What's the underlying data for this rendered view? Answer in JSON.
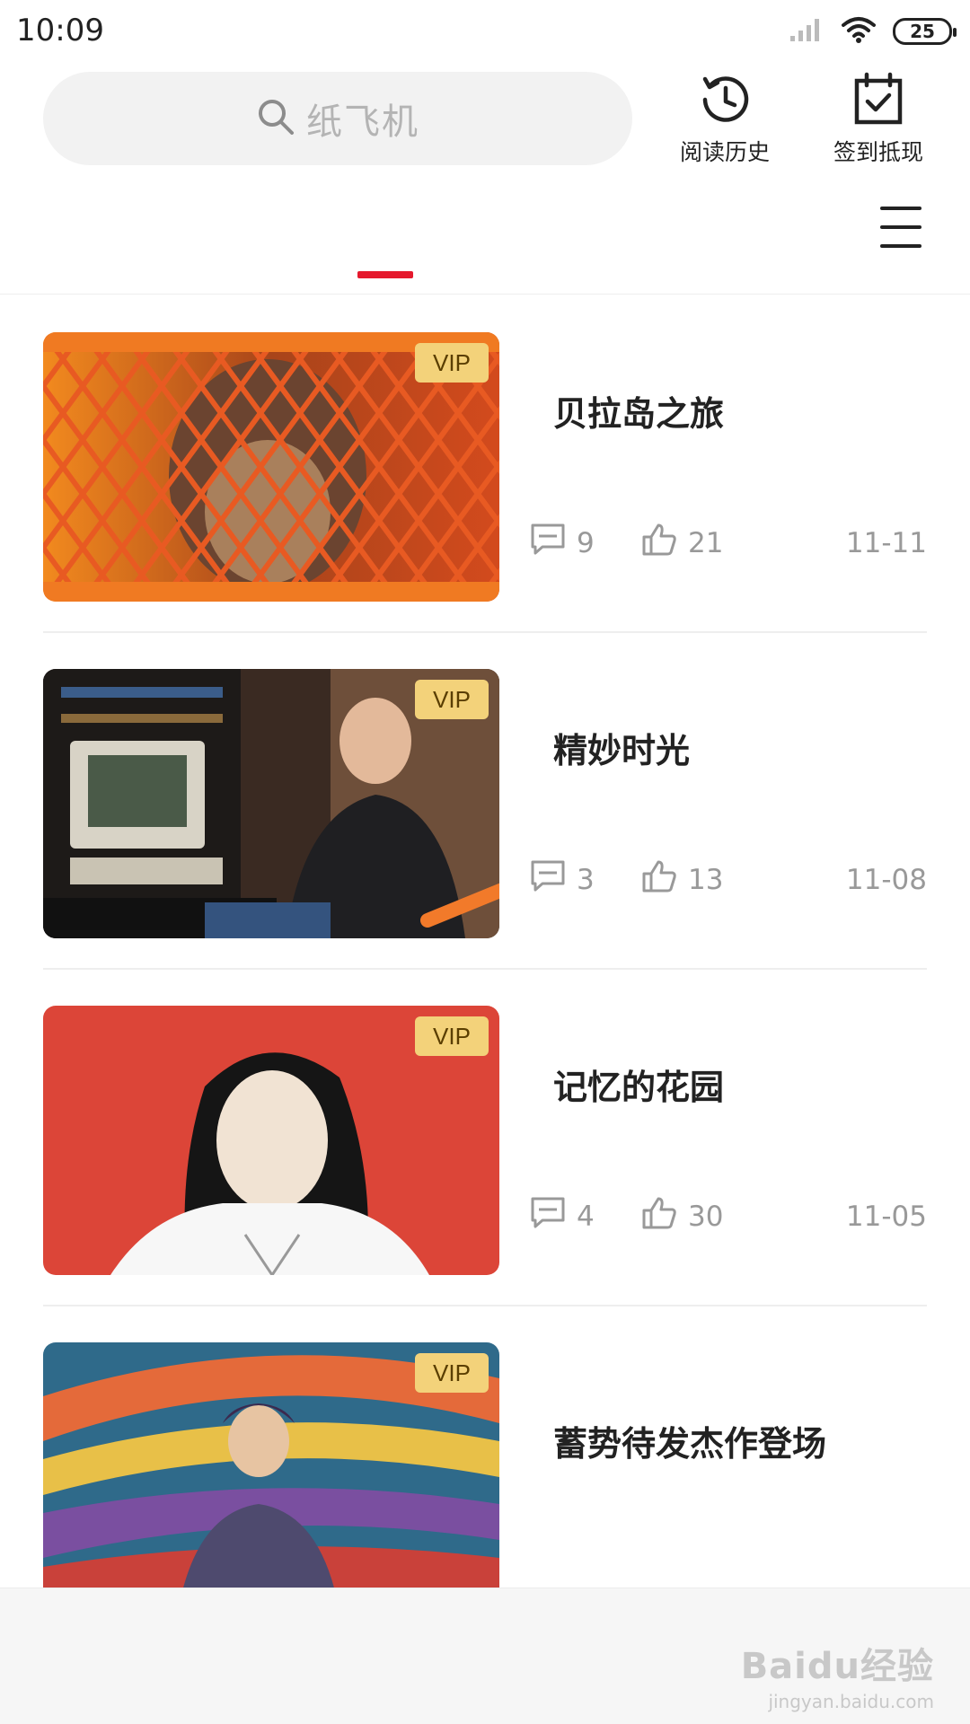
{
  "status_bar": {
    "time": "10:09",
    "battery": "25",
    "icons": [
      "signal-icon",
      "wifi-icon",
      "battery-icon"
    ]
  },
  "header": {
    "search_placeholder": "纸飞机",
    "history_label": "阅读历史",
    "checkin_label": "签到抵现"
  },
  "colors": {
    "accent": "#e5192d",
    "vip_badge": "#f3d27a",
    "meta_text": "#999999"
  },
  "feed": {
    "items": [
      {
        "title": "贝拉岛之旅",
        "comments": "9",
        "likes": "21",
        "date": "11-11",
        "badge": "VIP"
      },
      {
        "title": "精妙时光",
        "comments": "3",
        "likes": "13",
        "date": "11-08",
        "badge": "VIP"
      },
      {
        "title": "记忆的花园",
        "comments": "4",
        "likes": "30",
        "date": "11-05",
        "badge": "VIP"
      },
      {
        "title": "蓄势待发杰作登场",
        "comments": "",
        "likes": "",
        "date": "",
        "badge": "VIP"
      }
    ]
  },
  "watermark": {
    "brand": "Baidu经验",
    "site": "jingyan.baidu.com"
  }
}
